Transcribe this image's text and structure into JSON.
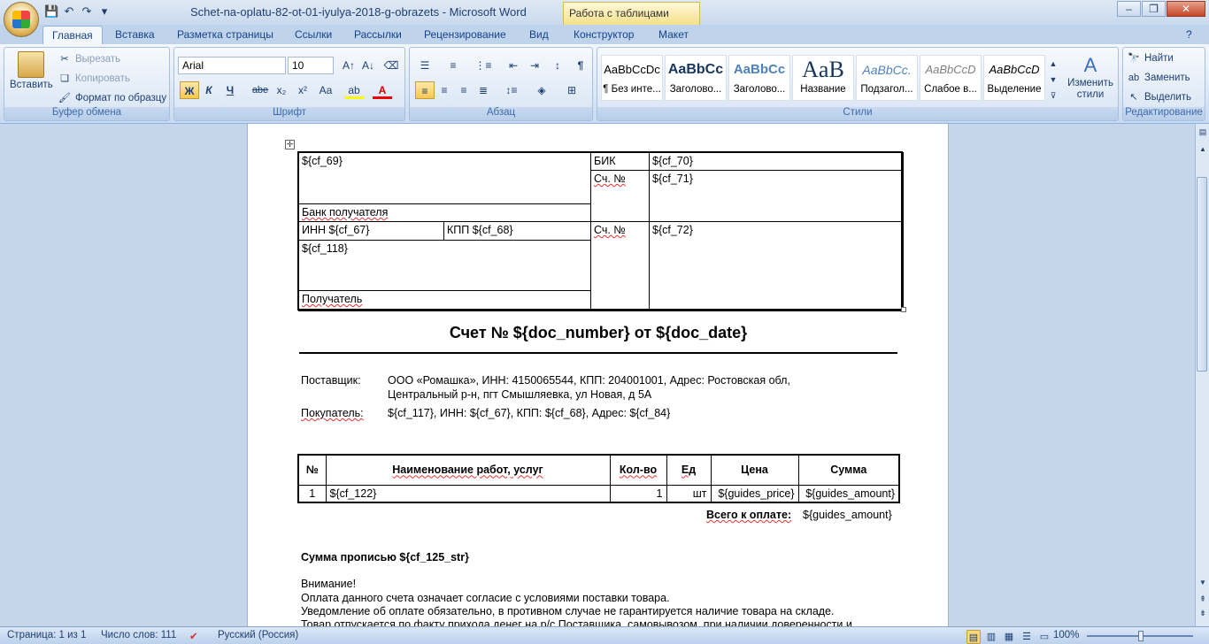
{
  "window": {
    "title": "Schet-na-oplatu-82-ot-01-iyulya-2018-g-obrazets - Microsoft Word",
    "contextual_tab_group": "Работа с таблицами"
  },
  "ribbon_tabs": [
    "Главная",
    "Вставка",
    "Разметка страницы",
    "Ссылки",
    "Рассылки",
    "Рецензирование",
    "Вид",
    "Конструктор",
    "Макет"
  ],
  "clipboard": {
    "paste": "Вставить",
    "cut": "Вырезать",
    "copy": "Копировать",
    "format_painter": "Формат по образцу",
    "label": "Буфер обмена"
  },
  "font": {
    "name": "Arial",
    "size": "10",
    "label": "Шрифт",
    "bold": "Ж",
    "italic": "К",
    "underline": "Ч",
    "strike": "abe",
    "sub": "x₂",
    "sup": "x²",
    "case": "Aa"
  },
  "paragraph": {
    "label": "Абзац"
  },
  "styles": {
    "label": "Стили",
    "items": [
      {
        "preview": "AaBbCcDc",
        "name": "¶ Без инте..."
      },
      {
        "preview": "AaBbCc",
        "name": "Заголово..."
      },
      {
        "preview": "AaBbCc",
        "name": "Заголово..."
      },
      {
        "preview": "AaB",
        "name": "Название"
      },
      {
        "preview": "AaBbCc.",
        "name": "Подзагол..."
      },
      {
        "preview": "AaBbCcD",
        "name": "Слабое в..."
      },
      {
        "preview": "AaBbCcD",
        "name": "Выделение"
      }
    ],
    "change_styles": "Изменить стили"
  },
  "editing": {
    "find": "Найти",
    "replace": "Заменить",
    "select": "Выделить",
    "label": "Редактирование"
  },
  "document": {
    "bank_table": {
      "bank_name": "${cf_69}",
      "bank_label": "Банк получателя",
      "bik_label": "БИК",
      "bik_value": "${cf_70}",
      "acc_label": "Сч. №",
      "acc_value": "${cf_71}",
      "inn": "ИНН ${cf_67}",
      "kpp": "КПП ${cf_68}",
      "acc2_label": "Сч. №",
      "acc2_value": "${cf_72}",
      "recipient_name": "${cf_118}",
      "recipient_label": "Получатель"
    },
    "invoice_title": "Счет № ${doc_number} от ${doc_date}",
    "supplier_label": "Поставщик:",
    "supplier_line1": "ООО «Ромашка», ИНН: 4150065544,  КПП: 204001001,  Адрес: Ростовская  обл,",
    "supplier_line2": "Центральный р-н, пгт Смышляевка,  ул Новая,  д 5А",
    "buyer_label": "Покупатель:",
    "buyer_value": "${cf_117}, ИНН: ${cf_67}, КПП: ${cf_68}, Адрес: ${cf_84}",
    "items_headers": [
      "№",
      "Наименование  работ,  услуг",
      "Кол-во",
      "Ед",
      "Цена",
      "Сумма"
    ],
    "items_rows": [
      [
        "1",
        "${cf_122}",
        "1",
        "шт",
        "${guides_price}",
        "${guides_amount}"
      ]
    ],
    "total_label": "Всего  к  оплате:",
    "total_value": "${guides_amount}",
    "sum_words": "Сумма прописью ${cf_125_str}",
    "attention": "Внимание!",
    "note1": "Оплата данного счета  означает  согласие с условиями поставки товара.",
    "note2": "Уведомление  об оплате обязательно, в противном случае не  гарантируется наличие  товара на  складе.",
    "note3": "Товар отпускается по факту прихода денег на р/с Поставщика, самовывозом, при наличии доверенности и"
  },
  "status": {
    "page": "Страница: 1 из 1",
    "words": "Число слов: 111",
    "language": "Русский (Россия)",
    "zoom": "100%"
  }
}
